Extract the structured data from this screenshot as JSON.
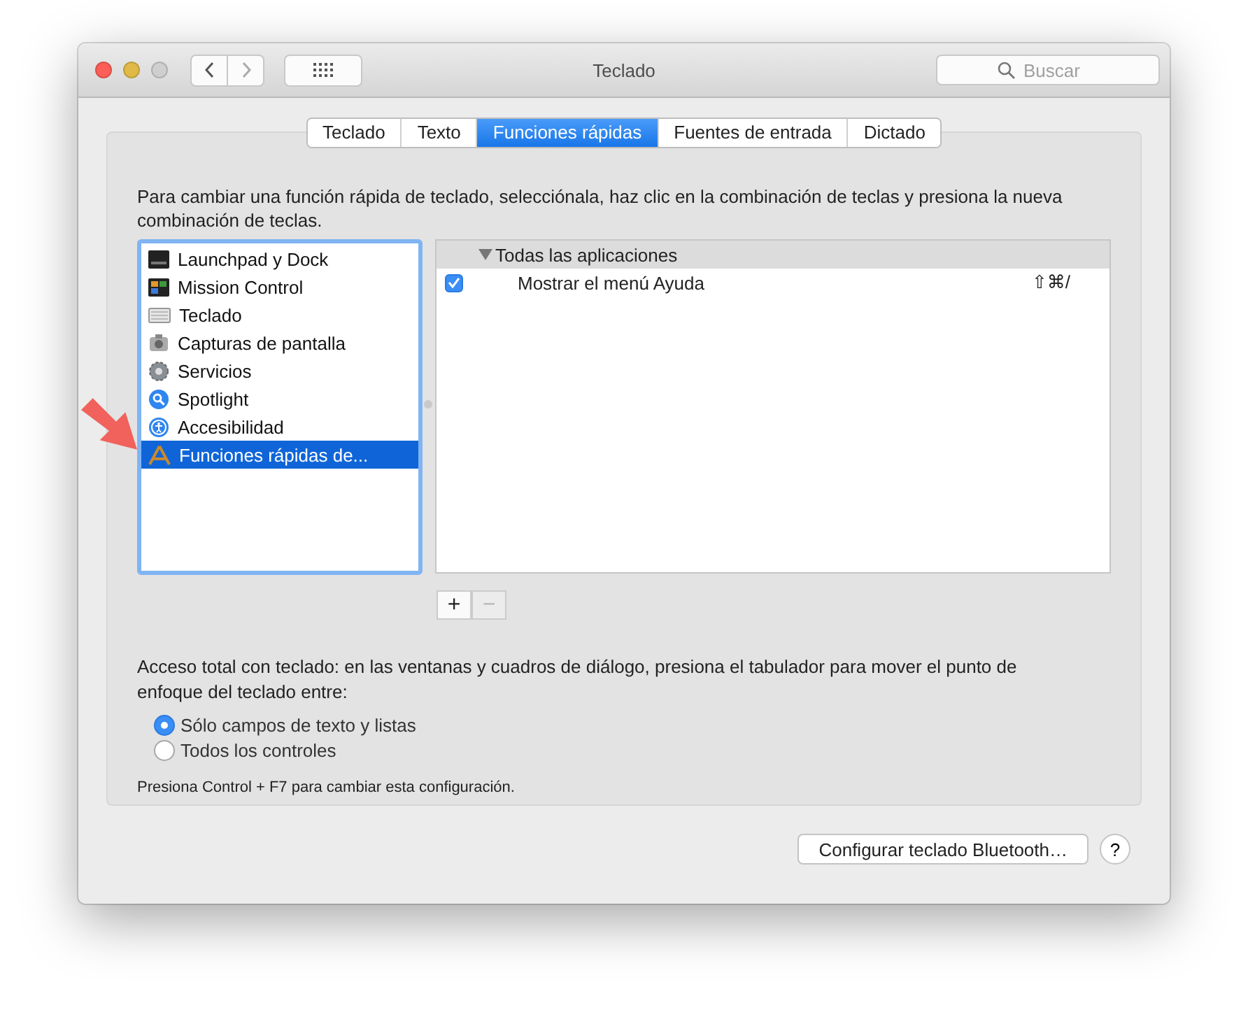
{
  "window": {
    "title": "Teclado",
    "search": {
      "placeholder": "Buscar"
    }
  },
  "tabs": [
    {
      "label": "Teclado",
      "selected": false
    },
    {
      "label": "Texto",
      "selected": false
    },
    {
      "label": "Funciones rápidas",
      "selected": true
    },
    {
      "label": "Fuentes de entrada",
      "selected": false
    },
    {
      "label": "Dictado",
      "selected": false
    }
  ],
  "description": "Para cambiar una función rápida de teclado, selecciónala, haz clic en la combinación de teclas y presiona la nueva combinación de teclas.",
  "categories": [
    {
      "label": "Launchpad y Dock",
      "selected": false
    },
    {
      "label": "Mission Control",
      "selected": false
    },
    {
      "label": "Teclado",
      "selected": false
    },
    {
      "label": "Capturas de pantalla",
      "selected": false
    },
    {
      "label": "Servicios",
      "selected": false
    },
    {
      "label": "Spotlight",
      "selected": false
    },
    {
      "label": "Accesibilidad",
      "selected": false
    },
    {
      "label": "Funciones rápidas de...",
      "selected": true
    }
  ],
  "shortcuts": {
    "group": {
      "label": "Todas las aplicaciones",
      "expanded": true
    },
    "items": [
      {
        "label": "Mostrar el menú Ayuda",
        "checked": true,
        "keys": "⇧⌘/"
      }
    ]
  },
  "list_buttons": [
    {
      "label": "+",
      "disabled": false
    },
    {
      "label": "−",
      "disabled": true
    }
  ],
  "access": {
    "text": "Acceso total con teclado: en las ventanas y cuadros de diálogo, presiona el tabulador para mover el punto de enfoque del teclado entre:",
    "options": [
      {
        "label": "Sólo campos de texto y listas",
        "selected": true
      },
      {
        "label": "Todos los controles",
        "selected": false
      }
    ],
    "note": "Presiona Control + F7 para cambiar esta configuración."
  },
  "bluetooth_button": "Configurar teclado Bluetooth…",
  "help_button": "?"
}
